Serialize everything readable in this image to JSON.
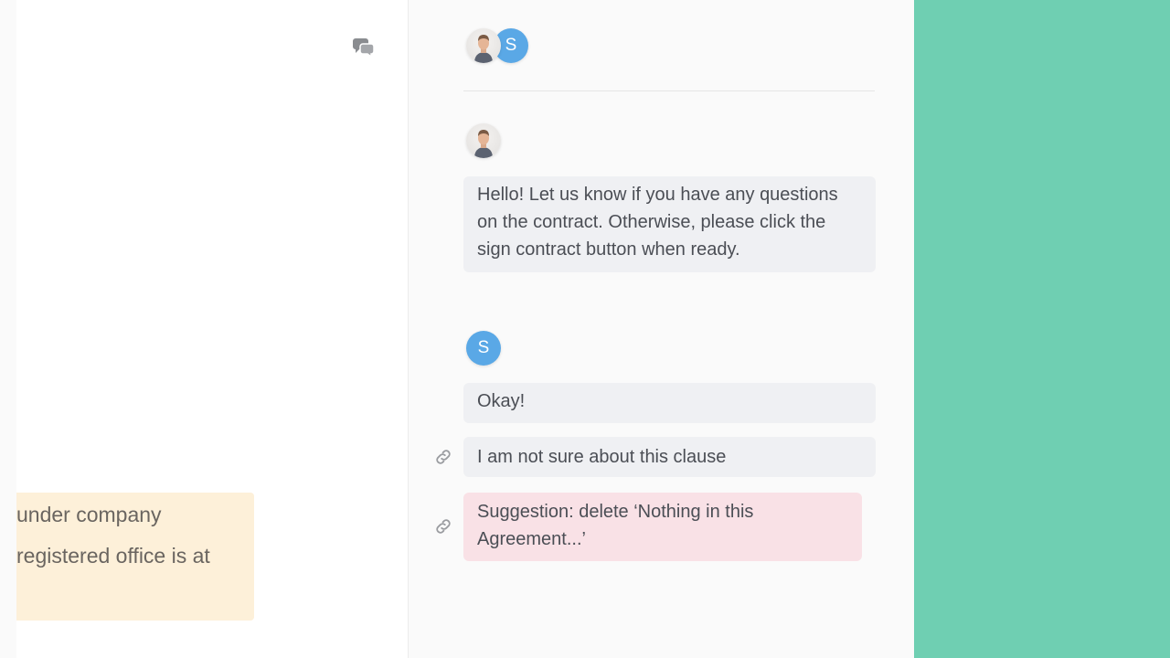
{
  "document": {
    "highlight_lines": [
      "under company",
      "registered office is at"
    ]
  },
  "chat": {
    "participants": [
      {
        "type": "photo"
      },
      {
        "type": "letter",
        "initial": "S"
      }
    ],
    "messages": [
      {
        "author": "photo",
        "text": "Hello! Let us know if you have any questions on the contract. Otherwise, please click the sign contract button when ready."
      },
      {
        "author": "S",
        "initial": "S",
        "text": "Okay!"
      },
      {
        "author": "S",
        "text": "I am not sure about this clause",
        "linked": true
      },
      {
        "author": "S",
        "text": "Suggestion: delete ‘Nothing in this Agreement...’",
        "linked": true,
        "style": "suggestion"
      }
    ]
  },
  "colors": {
    "accent_blue": "#5aa8e6",
    "highlight": "#fdf0d9",
    "suggestion": "#f9e1e6",
    "side_panel": "#6fcfb2"
  },
  "icons": {
    "chat_toggle": "chat-bubbles-icon",
    "link": "link-icon"
  }
}
